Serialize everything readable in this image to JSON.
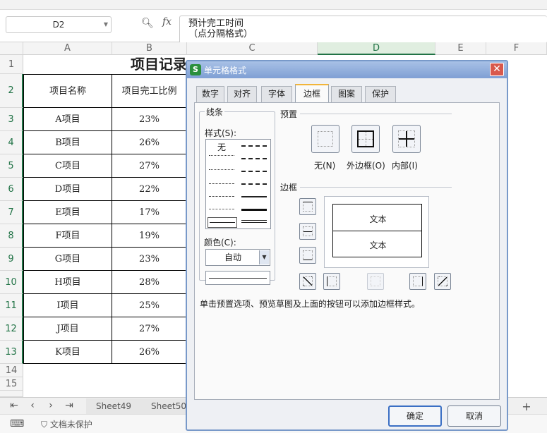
{
  "formula_bar": {
    "name_box": "D2",
    "fx_label": "fx",
    "formula_line1": "预计完工时间",
    "formula_line2": "（点分隔格式）"
  },
  "columns": [
    "A",
    "B",
    "C",
    "D",
    "E",
    "F"
  ],
  "selected_column": "D",
  "rows": [
    "1",
    "2",
    "3",
    "4",
    "5",
    "6",
    "7",
    "8",
    "9",
    "10",
    "11",
    "12",
    "13",
    "14",
    "15"
  ],
  "sheet": {
    "title": "项目记录",
    "header_a": "项目名称",
    "header_b": "项目完工比例",
    "data": [
      {
        "name": "A项目",
        "pct": "23%"
      },
      {
        "name": "B项目",
        "pct": "26%"
      },
      {
        "name": "C项目",
        "pct": "27%"
      },
      {
        "name": "D项目",
        "pct": "22%"
      },
      {
        "name": "E项目",
        "pct": "17%"
      },
      {
        "name": "F项目",
        "pct": "19%"
      },
      {
        "name": "G项目",
        "pct": "23%"
      },
      {
        "name": "H项目",
        "pct": "28%"
      },
      {
        "name": "I项目",
        "pct": "25%"
      },
      {
        "name": "J项目",
        "pct": "27%"
      },
      {
        "name": "K项目",
        "pct": "26%"
      }
    ]
  },
  "sheet_tabs": [
    "Sheet49",
    "Sheet50"
  ],
  "status": {
    "protect": "文档未保护"
  },
  "dialog": {
    "title": "单元格格式",
    "logo": "S",
    "close": "✕",
    "tabs": [
      "数字",
      "对齐",
      "字体",
      "边框",
      "图案",
      "保护"
    ],
    "active_tab": "边框",
    "line_group": "线条",
    "style_label": "样式(S):",
    "style_none": "无",
    "color_label": "颜色(C):",
    "color_value": "自动",
    "preset_group": "预置",
    "preset_none": "无(N)",
    "preset_outline": "外边框(O)",
    "preset_inside": "内部(I)",
    "border_group": "边框",
    "preview_text_1": "文本",
    "preview_text_2": "文本",
    "hint": "单击预置选项、预览草图及上面的按钮可以添加边框样式。",
    "ok": "确定",
    "cancel": "取消"
  }
}
